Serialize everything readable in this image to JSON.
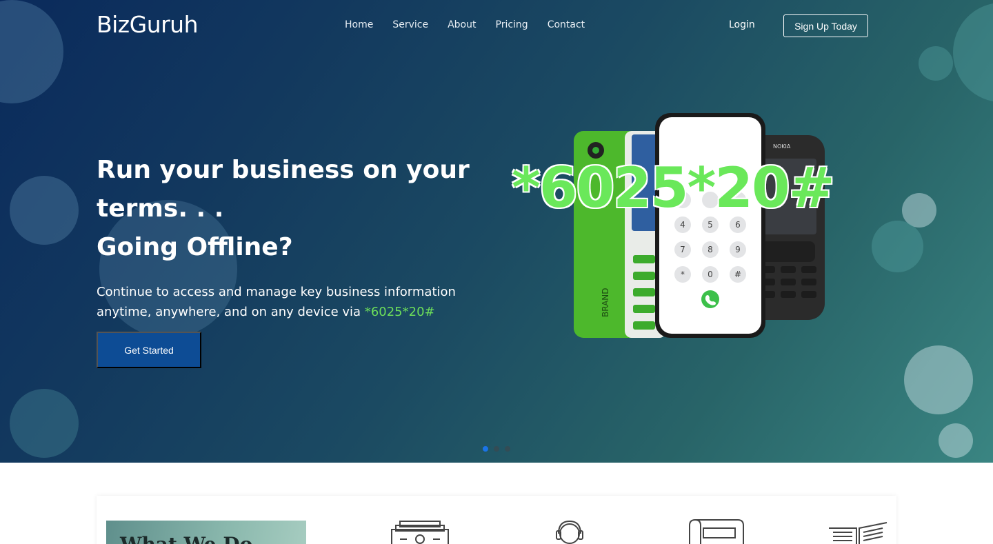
{
  "brand": {
    "logo": "BizGuruh"
  },
  "nav": {
    "links": [
      "Home",
      "Service",
      "About",
      "Pricing",
      "Contact"
    ],
    "login": "Login",
    "signup": "Sign Up Today"
  },
  "hero": {
    "headline_line1": "Run your business on your",
    "headline_line2": "terms. . .",
    "headline_line3": "Going Offline?",
    "description": "Continue to access and manage key business information anytime, anywhere, and on any device via ",
    "description_code": "*6025*20#",
    "cta": "Get Started",
    "ussd_code": "*6025*20#",
    "phone_brand_label": "BRAND",
    "phone_nokia_label": "NOKIA",
    "slide_count": 3,
    "active_slide": 1
  },
  "services": {
    "what_we_do": "What We Do",
    "icons": [
      "money-icon",
      "headset-support-icon",
      "document-scroll-icon",
      "open-book-icon"
    ]
  },
  "colors": {
    "accent_green": "#6dde5a",
    "cta_blue": "#0d4c95",
    "active_dot": "#1a74e8"
  }
}
